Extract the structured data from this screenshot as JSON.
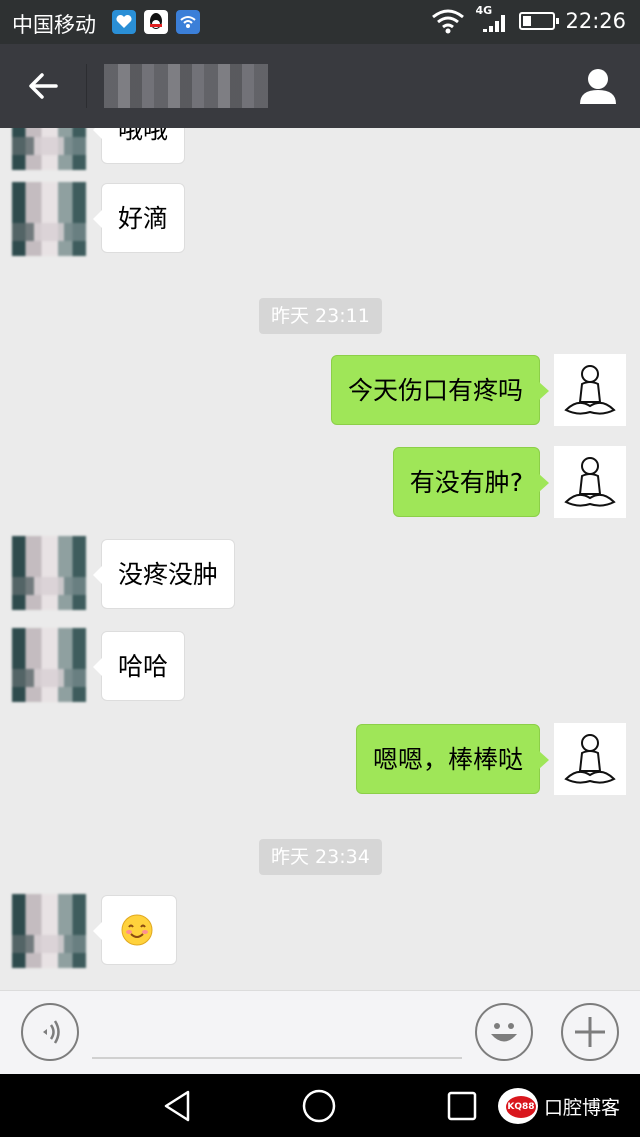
{
  "status_bar": {
    "carrier": "中国移动",
    "network": "4G",
    "time": "22:26"
  },
  "title_bar": {
    "contact_name": "",
    "back_icon": "arrow-left-icon",
    "profile_icon": "person-icon"
  },
  "messages": [
    {
      "side": "in",
      "text": "哦哦"
    },
    {
      "side": "in",
      "text": "好滴"
    },
    {
      "type": "time",
      "text": "昨天 23:11"
    },
    {
      "side": "out",
      "text": "今天伤口有疼吗"
    },
    {
      "side": "out",
      "text": "有没有肿?"
    },
    {
      "side": "in",
      "text": "没疼没肿"
    },
    {
      "side": "in",
      "text": "哈哈"
    },
    {
      "side": "out",
      "text": "嗯嗯，棒棒哒"
    },
    {
      "type": "time",
      "text": "昨天 23:34"
    },
    {
      "side": "in",
      "emoji": "smiling-face-emoji"
    }
  ],
  "input_bar": {
    "voice_icon": "voice-icon",
    "emoji_icon": "smiley-icon",
    "plus_icon": "plus-icon"
  },
  "nav_bar": {
    "watermark_logo_text": "KQ88",
    "watermark_text": "口腔博客"
  },
  "colors": {
    "outgoing_bubble": "#9fe658",
    "incoming_bubble": "#ffffff",
    "chat_background": "#ebebeb",
    "title_bar": "#393a3f"
  }
}
